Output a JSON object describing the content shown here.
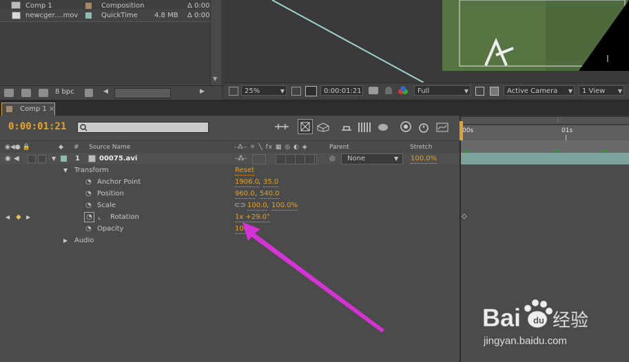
{
  "project": {
    "items": [
      {
        "name": "Comp 1",
        "type": "Composition",
        "size": "",
        "duration": "Δ 0:00",
        "color": "#a08a6a"
      },
      {
        "name": "newcger....mov",
        "type": "QuickTime",
        "size": "4.8 MB",
        "duration": "Δ 0:00",
        "color": "#8fb9b1"
      }
    ],
    "bpc": "8 bpc"
  },
  "viewer": {
    "zoom": "25%",
    "timecode": "0:00:01:21",
    "resolution": "Full",
    "camera": "Active Camera",
    "view": "1 View"
  },
  "timeline": {
    "tab_label": "Comp 1",
    "timecode": "0:00:01:21",
    "columns": {
      "num": "#",
      "source_name": "Source Name",
      "parent": "Parent",
      "stretch": "Stretch"
    },
    "layer": {
      "index": "1",
      "name": "00075.avi",
      "parent": "None",
      "stretch": "100.0%"
    },
    "transform": {
      "label": "Transform",
      "reset": "Reset",
      "properties": [
        {
          "name": "Anchor Point",
          "value1": "1906.0",
          "value2": "35.0"
        },
        {
          "name": "Position",
          "value1": "960.0",
          "value2": "540.0"
        },
        {
          "name": "Scale",
          "value1": "100.0",
          "value2": "100.0%"
        },
        {
          "name": "Rotation",
          "value1": "1x +29.0°",
          "value2": ""
        },
        {
          "name": "Opacity",
          "value1": "100",
          "value2": ""
        }
      ]
    },
    "audio_label": "Audio",
    "ruler": {
      "t0": "00s",
      "t1": "01s"
    }
  },
  "colors": {
    "accent": "#e0a22a",
    "annotation_arrow": "#d633d6",
    "layer_bar": "#7da29c"
  },
  "watermark": {
    "brand": "Baidu",
    "brand_cn": "经验",
    "url": "jingyan.baidu.com"
  }
}
